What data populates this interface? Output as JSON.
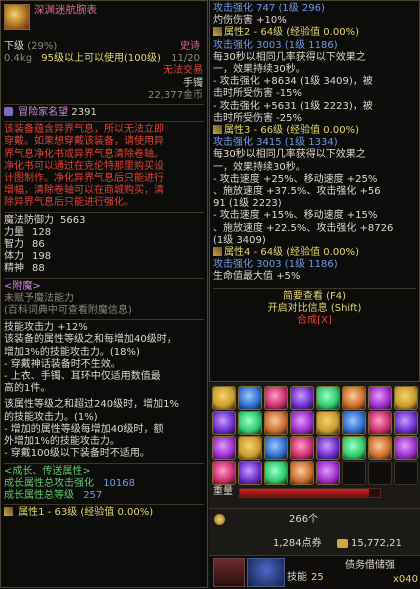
{
  "left": {
    "title": "深渊迷航腕表",
    "rarity_label": "下级",
    "rarity_pct": "(29%)",
    "grade": "史诗",
    "weight": "0.4kg",
    "level_req": "95级以上可以使用(100级)",
    "cnt": "11/20",
    "no_trade": "无法交易",
    "slot_type": "手镯",
    "price": "22,377金币",
    "adventurer_label": "冒险家名望",
    "adventurer_value": "2391",
    "warning_lines": [
      "该装备蕴含异界气息，所以无法立即",
      "穿戴。如果想穿戴该装备，请使用异",
      "界气息净化书或异界气息清除卷轴。",
      "净化书可以通过在克伦特那里购买设",
      "计图制作。净化异界气息后只能进行",
      "增幅，清除卷轴可以在商城购买，清",
      "除异界气息后只能进行强化。"
    ],
    "stats": [
      {
        "label": "魔法防御力",
        "value": "5663"
      },
      {
        "label": "力量",
        "value": "128"
      },
      {
        "label": "智力",
        "value": "86"
      },
      {
        "label": "体力",
        "value": "198"
      },
      {
        "label": "精神",
        "value": "88"
      }
    ],
    "enchant_header": "<附魔>",
    "enchant_none": "未赋予魔法能力",
    "enchant_hint": "(百科词典中可查看附魔信息)",
    "skill_attack": "技能攻击力 +12%",
    "desc1": [
      "该装备的属性等级之和每增加40级时，",
      "增加3%的技能攻击力。(18%)",
      "- 穿戴神话装备时不生效。",
      "- 上衣、手镯、耳环中仅适用数值最",
      "高的1件。"
    ],
    "desc2": [
      "该属性等级之和超过240级时，增加1%",
      "的技能攻击力。(1%)",
      "- 增加的属性等级每增加40级时，额",
      "外增加1%的技能攻击力。",
      "- 穿戴100级以下装备时不适用。"
    ],
    "growth_header": "<成长、传送属性>",
    "growth_attack_label": "成长属性总攻击强化",
    "growth_attack_value": "10168",
    "growth_level_label": "成长属性总等级",
    "growth_level_value": "257",
    "prop1": "属性1 - 63级 (经验值 0.00%)"
  },
  "right": {
    "lines": [
      {
        "c": "bl",
        "t": "攻击强化 747 (1级 296)"
      },
      {
        "c": "wt",
        "t": "灼伤伤害 +10%"
      },
      {
        "c": "y",
        "t": "属性2 - 64级 (经验值 0.00%)",
        "h": true
      },
      {
        "c": "bl",
        "t": "攻击强化 3003 (1级 1186)"
      },
      {
        "c": "wt",
        "t": "每30秒以相同几率获得以下效果之"
      },
      {
        "c": "wt",
        "t": "一，效果持续30秒。"
      },
      {
        "c": "wt",
        "t": "- 攻击强化 +8634 (1级 3409)，被"
      },
      {
        "c": "wt",
        "t": "击时所受伤害 -15%"
      },
      {
        "c": "wt",
        "t": "- 攻击强化 +5631 (1级 2223)，被"
      },
      {
        "c": "wt",
        "t": "击时所受伤害 -25%"
      },
      {
        "c": "y",
        "t": "属性3 - 66级 (经验值 0.00%)",
        "h": true
      },
      {
        "c": "bl",
        "t": "攻击强化 3415 (1级 1334)"
      },
      {
        "c": "wt",
        "t": "每30秒以相同几率获得以下效果之"
      },
      {
        "c": "wt",
        "t": "一，效果持续30秒。"
      },
      {
        "c": "wt",
        "t": "- 攻击速度 +25%、移动速度 +25%"
      },
      {
        "c": "wt",
        "t": "、施放速度 +37.5%、攻击强化 +56"
      },
      {
        "c": "wt",
        "t": "91 (1级 2223)"
      },
      {
        "c": "wt",
        "t": "- 攻击速度 +15%、移动速度 +15%"
      },
      {
        "c": "wt",
        "t": "、施放速度 +22.5%、攻击强化 +8726"
      },
      {
        "c": "wt",
        "t": "(1级 3409)"
      },
      {
        "c": "y",
        "t": "属性4 - 64级 (经验值 0.00%)",
        "h": true
      },
      {
        "c": "bl",
        "t": "攻击强化 3003 (1级 1186)"
      },
      {
        "c": "wt",
        "t": "生命值最大值 +5%"
      }
    ],
    "btn_compare_brief": "简要查看 (F4)",
    "btn_compare": "开启对比信息 (Shift)",
    "btn_compose": "合成[X]"
  },
  "inventory": {
    "weight_label": "重量",
    "coin_count": "266个",
    "points": "1,284点券",
    "gold": "15,772,21",
    "skill_label": "技能",
    "skill_value": "25",
    "bottom_text": "债务借储强",
    "bottom_count": "x040"
  }
}
